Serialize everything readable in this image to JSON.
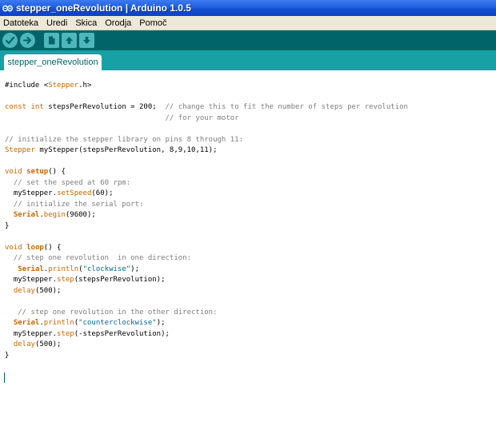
{
  "window": {
    "title": "stepper_oneRevolution | Arduino 1.0.5"
  },
  "menu": [
    "Datoteka",
    "Uredi",
    "Skica",
    "Orodja",
    "Pomoč"
  ],
  "toolbar": {
    "buttons": [
      "verify",
      "upload",
      "new",
      "open",
      "save"
    ],
    "accent_color": "#006468",
    "tab_strip_color": "#17a1a5"
  },
  "tab": {
    "label": "stepper_oneRevolution"
  },
  "editor": {
    "lines": [
      [
        [
          "#include <",
          "pl"
        ],
        [
          "Stepper",
          "kw"
        ],
        [
          ".h>",
          "pl"
        ]
      ],
      [],
      [
        [
          "const",
          "kw"
        ],
        [
          " ",
          "pl"
        ],
        [
          "int",
          "kw"
        ],
        [
          " stepsPerRevolution = 200;  ",
          "pl"
        ],
        [
          "// change this to fit the number of steps per revolution",
          "cm"
        ]
      ],
      [
        [
          "                                     // for your motor",
          "cm"
        ]
      ],
      [],
      [
        [
          "// initialize the stepper library on pins 8 through 11:",
          "cm"
        ]
      ],
      [
        [
          "Stepper",
          "kw"
        ],
        [
          " myStepper(stepsPerRevolution, 8,9,10,11);",
          "pl"
        ]
      ],
      [],
      [
        [
          "void",
          "kw"
        ],
        [
          " ",
          "pl"
        ],
        [
          "setup",
          "fnb"
        ],
        [
          "() {",
          "pl"
        ]
      ],
      [
        [
          "  ",
          "pl"
        ],
        [
          "// set the speed at 60 rpm:",
          "cm"
        ]
      ],
      [
        [
          "  myStepper.",
          "pl"
        ],
        [
          "setSpeed",
          "fn"
        ],
        [
          "(60);",
          "pl"
        ]
      ],
      [
        [
          "  ",
          "pl"
        ],
        [
          "// initialize the serial port:",
          "cm"
        ]
      ],
      [
        [
          "  ",
          "pl"
        ],
        [
          "Serial",
          "fnb"
        ],
        [
          ".",
          "pl"
        ],
        [
          "begin",
          "fn"
        ],
        [
          "(9600);",
          "pl"
        ]
      ],
      [
        [
          "}",
          "pl"
        ]
      ],
      [],
      [
        [
          "void",
          "kw"
        ],
        [
          " ",
          "pl"
        ],
        [
          "loop",
          "fnb"
        ],
        [
          "() {",
          "pl"
        ]
      ],
      [
        [
          "  ",
          "pl"
        ],
        [
          "// step one revolution  in one direction:",
          "cm"
        ]
      ],
      [
        [
          "   ",
          "pl"
        ],
        [
          "Serial",
          "fnb"
        ],
        [
          ".",
          "pl"
        ],
        [
          "println",
          "fn"
        ],
        [
          "(",
          "pl"
        ],
        [
          "\"clockwise\"",
          "st"
        ],
        [
          ");",
          "pl"
        ]
      ],
      [
        [
          "  myStepper.",
          "pl"
        ],
        [
          "step",
          "fn"
        ],
        [
          "(stepsPerRevolution);",
          "pl"
        ]
      ],
      [
        [
          "  ",
          "pl"
        ],
        [
          "delay",
          "fn"
        ],
        [
          "(500);",
          "pl"
        ]
      ],
      [],
      [
        [
          "   ",
          "pl"
        ],
        [
          "// step one revolution in the other direction:",
          "cm"
        ]
      ],
      [
        [
          "  ",
          "pl"
        ],
        [
          "Serial",
          "fnb"
        ],
        [
          ".",
          "pl"
        ],
        [
          "println",
          "fn"
        ],
        [
          "(",
          "pl"
        ],
        [
          "\"counterclockwise\"",
          "st"
        ],
        [
          ");",
          "pl"
        ]
      ],
      [
        [
          "  myStepper.",
          "pl"
        ],
        [
          "step",
          "fn"
        ],
        [
          "(-stepsPerRevolution);",
          "pl"
        ]
      ],
      [
        [
          "  ",
          "pl"
        ],
        [
          "delay",
          "fn"
        ],
        [
          "(500);",
          "pl"
        ]
      ],
      [
        [
          "}",
          "pl"
        ]
      ],
      []
    ],
    "syntax_colors": {
      "keyword": "#cc6600",
      "comment": "#7e7e7e",
      "string": "#006699",
      "plain": "#000000"
    },
    "cursor_line": 27
  }
}
